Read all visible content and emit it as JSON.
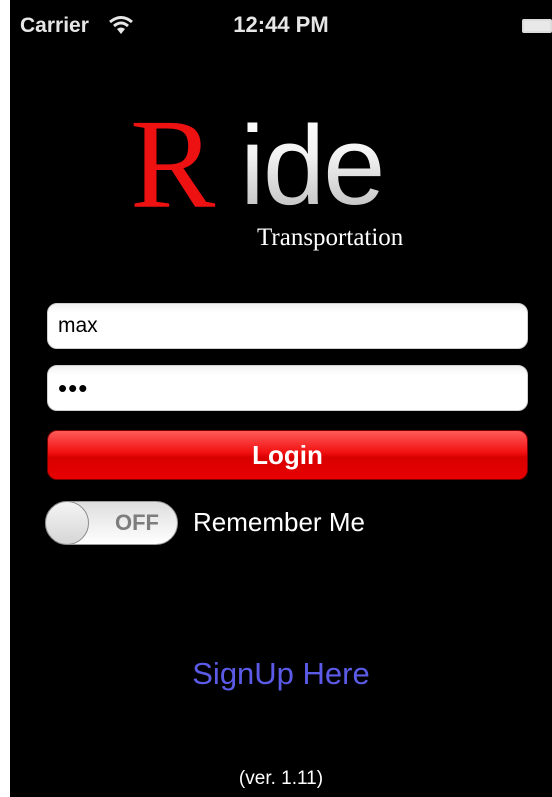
{
  "status_bar": {
    "carrier": "Carrier",
    "time": "12:44 PM",
    "wifi_icon": "wifi-icon",
    "battery_icon": "battery-icon"
  },
  "logo": {
    "r": "R",
    "ide": "ide",
    "subtitle": "Transportation",
    "accent_color": "#ee1111"
  },
  "login_form": {
    "username_value": "max",
    "password_value": "•••",
    "login_label": "Login",
    "login_color": "#e80000"
  },
  "remember": {
    "toggle_state": "OFF",
    "label": "Remember Me"
  },
  "signup": {
    "label": "SignUp Here",
    "color": "#5b5be8"
  },
  "footer": {
    "version": "(ver. 1.11)"
  }
}
